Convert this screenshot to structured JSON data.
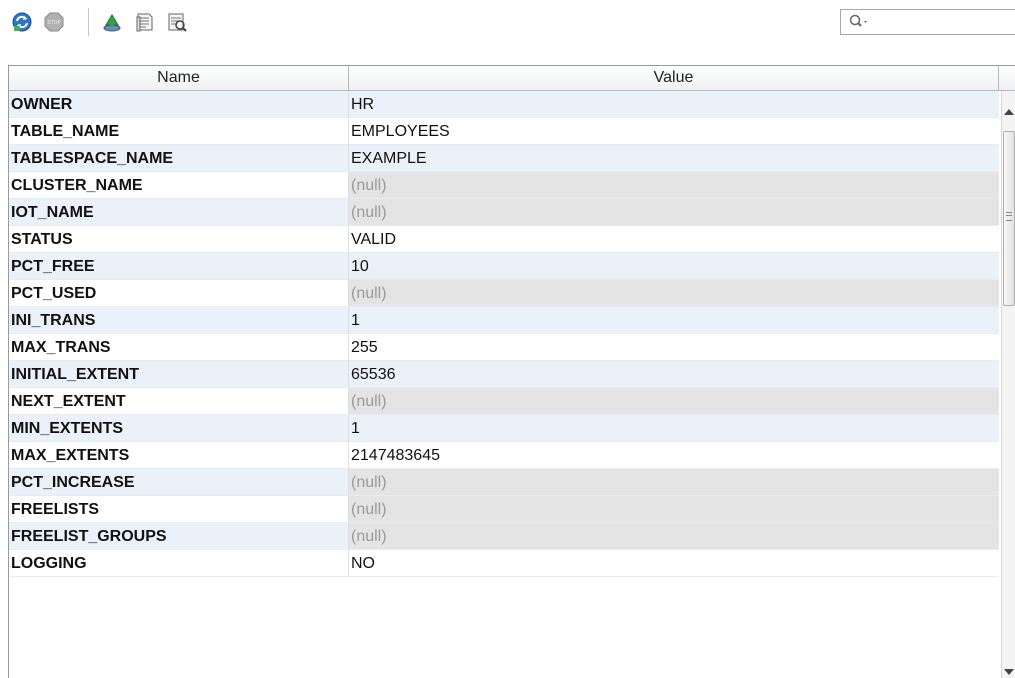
{
  "toolbar": {
    "icons": [
      "refresh-icon",
      "stop-icon",
      "run-icon",
      "sql-icon",
      "query-icon"
    ],
    "search_placeholder": ""
  },
  "grid": {
    "columns": [
      "Name",
      "Value"
    ],
    "rows": [
      {
        "name": "OWNER",
        "value": "HR",
        "is_null": false
      },
      {
        "name": "TABLE_NAME",
        "value": "EMPLOYEES",
        "is_null": false
      },
      {
        "name": "TABLESPACE_NAME",
        "value": "EXAMPLE",
        "is_null": false
      },
      {
        "name": "CLUSTER_NAME",
        "value": "(null)",
        "is_null": true
      },
      {
        "name": "IOT_NAME",
        "value": "(null)",
        "is_null": true
      },
      {
        "name": "STATUS",
        "value": "VALID",
        "is_null": false
      },
      {
        "name": "PCT_FREE",
        "value": "10",
        "is_null": false
      },
      {
        "name": "PCT_USED",
        "value": "(null)",
        "is_null": true
      },
      {
        "name": "INI_TRANS",
        "value": "1",
        "is_null": false
      },
      {
        "name": "MAX_TRANS",
        "value": "255",
        "is_null": false
      },
      {
        "name": "INITIAL_EXTENT",
        "value": "65536",
        "is_null": false
      },
      {
        "name": "NEXT_EXTENT",
        "value": "(null)",
        "is_null": true
      },
      {
        "name": "MIN_EXTENTS",
        "value": "1",
        "is_null": false
      },
      {
        "name": "MAX_EXTENTS",
        "value": "2147483645",
        "is_null": false
      },
      {
        "name": "PCT_INCREASE",
        "value": "(null)",
        "is_null": true
      },
      {
        "name": "FREELISTS",
        "value": "(null)",
        "is_null": true
      },
      {
        "name": "FREELIST_GROUPS",
        "value": "(null)",
        "is_null": true
      },
      {
        "name": "LOGGING",
        "value": "NO",
        "is_null": false
      }
    ]
  }
}
